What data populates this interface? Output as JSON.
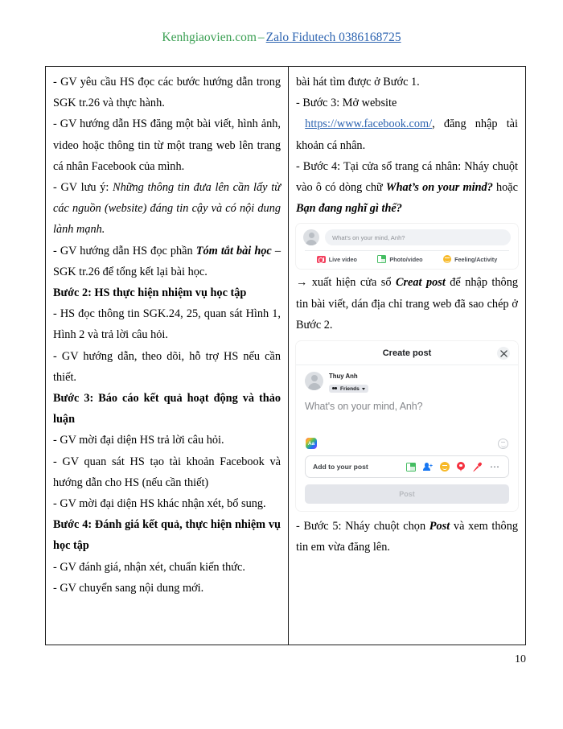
{
  "header": {
    "site": "Kenhgiaovien.com",
    "separator": "–",
    "contact": "Zalo Fidutech 0386168725",
    "site_color": "#3a9f52",
    "contact_color": "#2c63b0"
  },
  "table": {
    "left_column": {
      "paragraphs": [
        {
          "id": "p1",
          "text": "- GV yêu cầu HS đọc các bước hướng dẫn trong SGK tr.26 và thực hành."
        },
        {
          "id": "p2",
          "text": "- GV hướng dẫn HS đăng một bài viết, hình ảnh, video hoặc thông tin từ một trang web lên trang cá nhân Facebook của mình."
        },
        {
          "id": "p3_lead",
          "text": "- GV lưu ý: "
        },
        {
          "id": "p3_italic",
          "text": "Những thông tin đưa lên cần lấy từ các nguồn (website) đáng tin cậy và có nội dung lành mạnh."
        },
        {
          "id": "p4_lead",
          "text": "- GV hướng dẫn HS đọc phần "
        },
        {
          "id": "p4_bi",
          "text": "Tóm tắt bài học"
        },
        {
          "id": "p4_tail",
          "text": " – SGK tr.26 để tổng kết lại bài học."
        },
        {
          "id": "h_buoc2",
          "text": "Bước 2: HS thực hiện nhiệm vụ học tập"
        },
        {
          "id": "p5",
          "text": "- HS đọc thông tin SGK.24, 25, quan sát Hình 1, Hình 2 và trả lời câu hỏi."
        },
        {
          "id": "p6",
          "text": "- GV hướng dẫn, theo dõi, hỗ trợ HS nếu cần thiết."
        },
        {
          "id": "h_buoc3",
          "text": "Bước 3: Báo cáo kết quả hoạt động và thảo luận"
        },
        {
          "id": "p7",
          "text": "- GV mời đại diện HS trả lời câu hỏi."
        },
        {
          "id": "p8",
          "text": "- GV quan sát HS tạo tài khoản Facebook và hướng dẫn cho HS (nếu cần thiết)"
        },
        {
          "id": "p9",
          "text": "- GV mời đại diện HS khác nhận xét, bổ sung."
        },
        {
          "id": "h_buoc4",
          "text": "Bước 4: Đánh giá kết quả, thực hiện nhiệm vụ học tập"
        },
        {
          "id": "p10",
          "text": "- GV đánh giá, nhận xét, chuẩn kiến thức."
        },
        {
          "id": "p11",
          "text": "- GV chuyển sang nội dung mới."
        }
      ]
    },
    "right_column": {
      "p_top": "bài hát tìm được ở Bước 1.",
      "p_buoc3": "- Bước 3: Mở website",
      "link_text": "https://www.facebook.com/",
      "p_buoc3_tail": ", đăng nhập tài khoản cá nhân.",
      "p_buoc4_lead": "- Bước 4: Tại cửa sổ trang cá nhân: Nháy chuột vào ô có dòng chữ ",
      "p_buoc4_bi1": "What’s on your mind?",
      "p_buoc4_mid": " hoặc ",
      "p_buoc4_bi2": "Bạn đang nghĩ gì thế?",
      "p_arrow_lead": "→ xuất hiện cửa sổ ",
      "p_arrow_bi": "Creat post",
      "p_arrow_tail": " để nhập thông tin bài viết, dán địa chỉ trang web đã sao chép ở Bước 2.",
      "p_buoc5_lead": "- Bước 5: Nháy chuột chọn ",
      "p_buoc5_bi": "Post",
      "p_buoc5_tail": " và xem thông tin em vừa đăng lên."
    }
  },
  "fb_composer": {
    "input_placeholder": "What's on your mind, Anh?",
    "actions": [
      {
        "label": "Live video",
        "icon": "live-video-icon",
        "color": "#f3425f"
      },
      {
        "label": "Photo/video",
        "icon": "photo-video-icon",
        "color": "#45bd62"
      },
      {
        "label": "Feeling/Activity",
        "icon": "feeling-activity-icon",
        "color": "#f7b928"
      }
    ]
  },
  "fb_dialog": {
    "title": "Create post",
    "close_icon": "close-icon",
    "user_name": "Thuy Anh",
    "audience": "Friends",
    "audience_icon": "friends-icon",
    "placeholder": "What's on your mind, Anh?",
    "text_style_icon": "Aa",
    "emoji_icon": "emoji-icon",
    "addbar_label": "Add to your post",
    "addbar_icons": [
      {
        "name": "photo-video-icon",
        "color": "#45bd62"
      },
      {
        "name": "tag-people-icon",
        "color": "#1877f2"
      },
      {
        "name": "feeling-activity-icon",
        "color": "#f7b928"
      },
      {
        "name": "check-in-icon",
        "color": "#f5313f"
      },
      {
        "name": "live-audio-icon",
        "color": "#f5313f"
      },
      {
        "name": "more-options-icon",
        "color": "#606770"
      }
    ],
    "post_button": "Post"
  },
  "footer": {
    "page_number": "10"
  }
}
